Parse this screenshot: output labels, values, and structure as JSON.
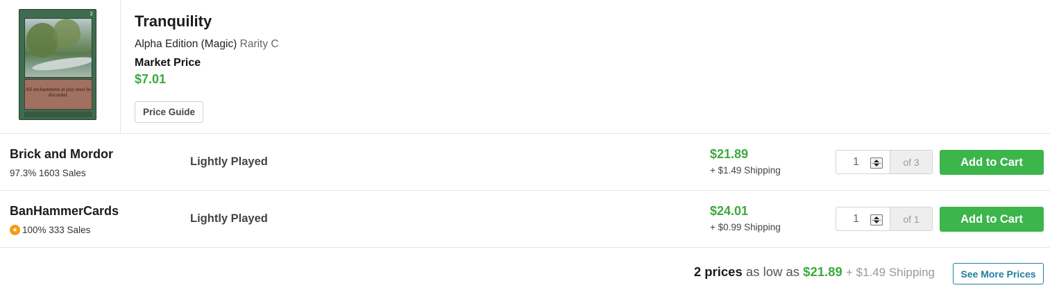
{
  "product": {
    "image_alt": "Tranquility card image",
    "card_text": "All enchantments in play must be discarded.",
    "card_mana": "2",
    "title": "Tranquility",
    "set_line": "Alpha Edition (Magic)",
    "rarity": "Rarity C",
    "market_price_label": "Market Price",
    "market_price": "$7.01",
    "price_guide_label": "Price Guide"
  },
  "listings": [
    {
      "seller": "Brick and Mordor",
      "stats": "97.3% 1603 Sales",
      "has_badge": false,
      "condition": "Lightly Played",
      "price": "$21.89",
      "shipping": "+ $1.49 Shipping",
      "quantity": "1",
      "available": "of 3",
      "add_label": "Add to Cart"
    },
    {
      "seller": "BanHammerCards",
      "stats": "100% 333 Sales",
      "has_badge": true,
      "badge_icon": "star-badge-icon",
      "condition": "Lightly Played",
      "price": "$24.01",
      "shipping": "+ $0.99 Shipping",
      "quantity": "1",
      "available": "of 1",
      "add_label": "Add to Cart"
    }
  ],
  "summary": {
    "count": "2 prices",
    "as_low_as": "as low as",
    "lowest_price": "$21.89",
    "shipping": "+ $1.49 Shipping",
    "see_more_label": "See More Prices"
  },
  "colors": {
    "price_green": "#3caa3c",
    "add_button_green": "#3cb54a",
    "link_blue": "#1f7ea0",
    "badge_orange": "#f39c12"
  }
}
